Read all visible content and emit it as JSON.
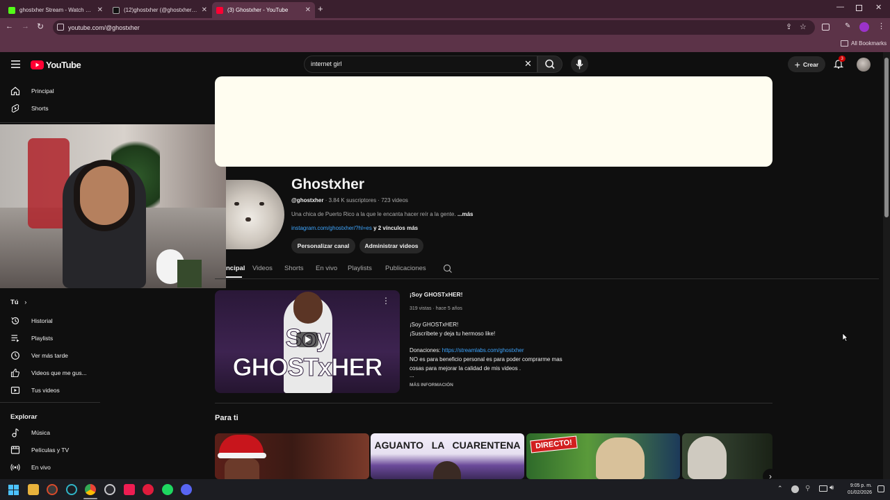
{
  "browser": {
    "tabs": [
      {
        "title": "ghostxher Stream - Watch Live",
        "color": "#53fc18"
      },
      {
        "title": "(12)ghostxher (@ghostxher) | TikTok",
        "color": "#ffffff"
      },
      {
        "title": "(3) Ghostxher - YouTube",
        "color": "#ff0033"
      }
    ],
    "url": "youtube.com/@ghostxher",
    "bookmarks_label": "All Bookmarks"
  },
  "youtube": {
    "logo_text": "YouTube",
    "search_value": "internet girl",
    "create_label": "Crear",
    "notif_count": "3",
    "banner_color": "#fffdf0",
    "sidebar": {
      "top": [
        {
          "label": "Principal",
          "icon": "home-icon"
        },
        {
          "label": "Shorts",
          "icon": "shorts-icon"
        }
      ],
      "you_header": "Tú",
      "you_items": [
        {
          "label": "Historial",
          "icon": "history-icon"
        },
        {
          "label": "Playlists",
          "icon": "playlists-icon"
        },
        {
          "label": "Ver más tarde",
          "icon": "clock-icon"
        },
        {
          "label": "Videos que me gus...",
          "icon": "thumbs-up-icon"
        },
        {
          "label": "Tus videos",
          "icon": "your-videos-icon"
        }
      ],
      "explore_header": "Explorar",
      "explore_items": [
        {
          "label": "Música",
          "icon": "music-icon"
        },
        {
          "label": "Películas y TV",
          "icon": "film-icon"
        },
        {
          "label": "En vivo",
          "icon": "live-icon"
        }
      ]
    },
    "channel": {
      "name": "Ghostxher",
      "handle": "@ghostxher",
      "stats": "· 3.84 K suscriptores · 723 videos",
      "description": "Una chica de Puerto Rico a la que le encanta hacer reír a la gente.",
      "more": "...más",
      "link": "instagram.com/ghostxher/?hl=es",
      "more_links": "y 2 vínculos más",
      "customize_button": "Personalizar canal",
      "manage_button": "Administrar videos"
    },
    "tabs": [
      "ncipal",
      "Videos",
      "Shorts",
      "En vivo",
      "Playlists",
      "Publicaciones"
    ],
    "featured": {
      "thumb_text": "Soy GHOSTxHER",
      "title": "¡Soy GHOSTxHER!",
      "meta": "319 vistas · hace 5 años",
      "desc1": "¡Soy GHOSTxHER!",
      "desc2": "¡Suscríbete y deja tu hermoso like!",
      "donation_label": "Donaciones: ",
      "donation_link": "https://streamlabs.com/ghostxher",
      "desc3": "NO es para beneficio personal es para poder comprarme mas",
      "desc4": "cosas para mejorar la calidad de mis videos .",
      "desc5": "...",
      "more_info": "MÁS INFORMACIÓN"
    },
    "for_you": {
      "heading": "Para ti",
      "thumbs": [
        {
          "text": "",
          "color": "#3a1a14"
        },
        {
          "text": "AGUANTO   LA   CUARENTENA",
          "color": "#e9e4f4"
        },
        {
          "text": "DIRECTO!",
          "color": "#3c6d2a"
        },
        {
          "text": "",
          "color": "#2d3a2a"
        }
      ]
    }
  },
  "taskbar": {
    "time": "9:05 p. m.",
    "date": "01/02/2026"
  }
}
